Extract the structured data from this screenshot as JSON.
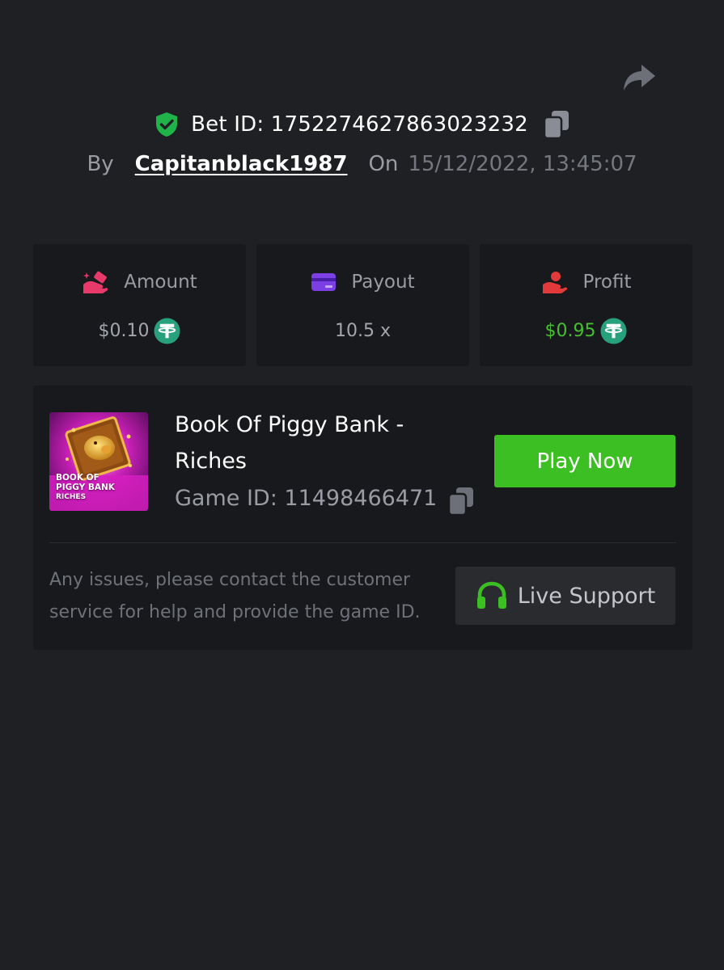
{
  "bet": {
    "id_label": "Bet ID: 1752274627863023232",
    "by_label": "By",
    "username": "Capitanblack1987",
    "on_label": "On",
    "datetime": "15/12/2022, 13:45:07"
  },
  "stats": {
    "amount": {
      "label": "Amount",
      "value": "$0.10",
      "icon": "money-hand-icon",
      "currency_icon": "tether-icon"
    },
    "payout": {
      "label": "Payout",
      "value": "10.5 x",
      "icon": "card-icon"
    },
    "profit": {
      "label": "Profit",
      "value": "$0.95",
      "icon": "profit-hand-icon",
      "currency_icon": "tether-icon"
    }
  },
  "game": {
    "title": "Book Of Piggy Bank - Riches",
    "thumb_lines": [
      "BOOK OF",
      "PIGGY BANK",
      "RICHES"
    ],
    "id_label": "Game ID: 11498466471",
    "play_label": "Play Now"
  },
  "support": {
    "help_text": "Any issues, please contact the customer service for help and provide the game ID.",
    "button_label": "Live Support"
  },
  "colors": {
    "background": "#1f2023",
    "card": "#18191c",
    "accent_green": "#3bbf22",
    "profit_green": "#46c030",
    "tether": "#26a17b",
    "amount_icon": "#e8396b",
    "payout_icon": "#7b3fe4",
    "profit_icon": "#e23a3a"
  }
}
